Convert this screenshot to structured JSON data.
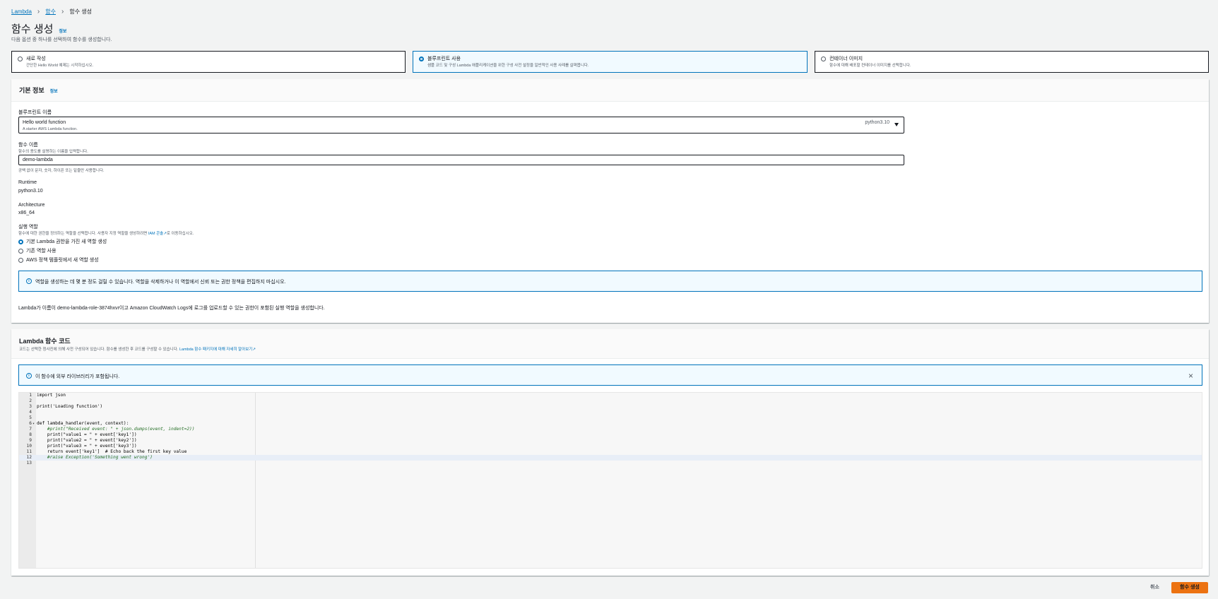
{
  "breadcrumb": {
    "items": [
      "Lambda",
      "함수"
    ],
    "current": "함수 생성"
  },
  "page": {
    "title": "함수 생성",
    "info": "정보",
    "subtitle": "다음 옵션 중 하나를 선택하여 함수를 생성합니다."
  },
  "options": [
    {
      "title": "새로 작성",
      "desc": "간단한 Hello World 예제는 시작하십시오."
    },
    {
      "title": "블루프린트 사용",
      "desc": "샘플 코드 및 구성 Lambda 애플리케이션을 위한 구성 사전 설정을 일반적인 사용 사례를 살펴봅니다."
    },
    {
      "title": "컨테이너 이미지",
      "desc": "함수에 대해 배포할 컨테이너 이미지를 선택합니다."
    }
  ],
  "basic": {
    "title": "기본 정보",
    "info": "정보",
    "blueprint_label": "블루프린트 이름",
    "blueprint_name": "Hello world function",
    "blueprint_desc": "A starter AWS Lambda function.",
    "blueprint_runtime": "python3.10",
    "fn_label": "함수 이름",
    "fn_sub": "함수의 용도를 설명하는 이름을 입력합니다.",
    "fn_value": "demo-lambda",
    "fn_hint": "공백 없이 문자, 숫자, 하이픈 또는 밑줄만 사용합니다.",
    "runtime_label": "Runtime",
    "runtime_value": "python3.10",
    "arch_label": "Architecture",
    "arch_value": "x86_64",
    "role_label": "실행 역할",
    "role_sub_pre": "함수에 대한 권한을 정의하는 역할을 선택합니다. 사용자 지정 역할을 생성하려면",
    "role_sub_link": "IAM 콘솔",
    "role_sub_post": "로 이동하십시오.",
    "role_options": [
      "기본 Lambda 권한을 가진 새 역할 생성",
      "기존 역할 사용",
      "AWS 정책 템플릿에서 새 역할 생성"
    ],
    "alert": "역할을 생성하는 데 몇 분 정도 걸릴 수 있습니다. 역할을 삭제하거나 이 역할에서 신뢰 또는 권한 정책을 편집하지 마십시오.",
    "role_note": "Lambda가 이름이 demo-lambda-role-3874hxvr이고 Amazon CloudWatch Logs에 로그를 업로드할 수 있는 권한이 포함된 실행 역할을 생성합니다."
  },
  "code": {
    "title": "Lambda 함수 코드",
    "sub_pre": "코드는 선택한 청사진에 의해 사전 구성되어 있습니다. 함수를 생성한 후 코드를 구성할 수 있습니다.",
    "sub_link": "Lambda 함수 패키지에 대해 자세히 알아보기",
    "alert": "이 함수에 외부 라이브러리가 포함됩니다.",
    "lines": [
      "import json",
      "",
      "print('Loading function')",
      "",
      "",
      "def lambda_handler(event, context):",
      "    #print(\"Received event: \" + json.dumps(event, indent=2))",
      "    print(\"value1 = \" + event['key1'])",
      "    print(\"value2 = \" + event['key2'])",
      "    print(\"value3 = \" + event['key3'])",
      "    return event['key1']  # Echo back the first key value",
      "    #raise Exception('Something went wrong')",
      ""
    ],
    "line_numbers": [
      "1",
      "2",
      "3",
      "4",
      "5",
      "6",
      "7",
      "8",
      "9",
      "10",
      "11",
      "12",
      "13"
    ]
  },
  "footer": {
    "cancel": "취소",
    "create": "함수 생성"
  },
  "colors": {
    "accent": "#0073bb",
    "primary_button": "#ec7211",
    "selected_bg": "#f1faff"
  }
}
